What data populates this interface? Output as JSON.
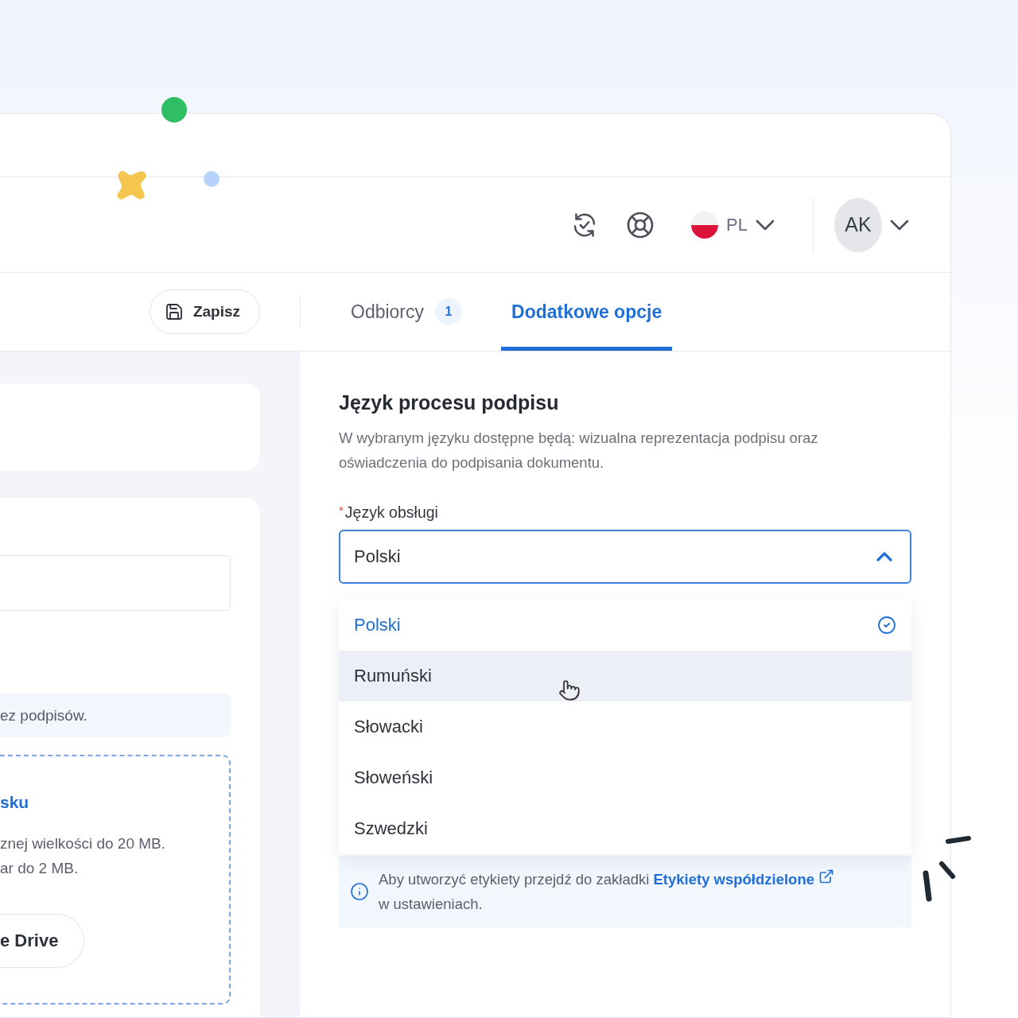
{
  "header": {
    "language": "PL",
    "avatar": "AK"
  },
  "toolbar": {
    "save_button": "Zapisz"
  },
  "tabs": [
    {
      "label": "Odbiorcy",
      "badge": "1",
      "selected": false
    },
    {
      "label": "Dodatkowe opcje",
      "selected": true
    }
  ],
  "left_panel": {
    "info_text": "ez podpisów.",
    "upload": {
      "title": "sku",
      "lines": [
        "znej wielkości do 20 MB.",
        "ar do 2 MB."
      ],
      "button": "e Drive"
    }
  },
  "section": {
    "title": "Język procesu podpisu",
    "description": "W wybranym języku dostępne będą: wizualna reprezentacja podpisu oraz oświadczenia do podpisania dokumentu.",
    "field": {
      "required_mark": "*",
      "label": "Język obsługi",
      "value": "Polski",
      "expanded": true,
      "options": [
        {
          "label": "Polski",
          "selected": true,
          "hovered": false
        },
        {
          "label": "Rumuński",
          "selected": false,
          "hovered": true
        },
        {
          "label": "Słowacki",
          "selected": false,
          "hovered": false
        },
        {
          "label": "Słoweński",
          "selected": false,
          "hovered": false
        },
        {
          "label": "Szwedzki",
          "selected": false,
          "hovered": false
        }
      ]
    },
    "info": {
      "text": "Aby utworzyć etykiety przejdź do zakładki",
      "link": "Etykiety współdzielone",
      "text_end": "w ustawieniach."
    }
  }
}
